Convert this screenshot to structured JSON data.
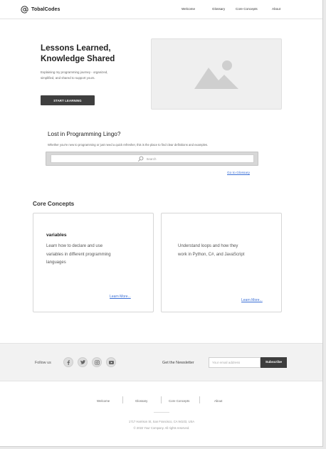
{
  "header": {
    "brand": "TobalCodes",
    "logo_icon": "at-sign-icon",
    "nav": [
      "Welcome",
      "Glossary",
      "Core Concepts",
      "About"
    ]
  },
  "hero": {
    "title_line1": "Lessons Learned,",
    "title_line2": "Knowledge Shared",
    "subtitle": "Explaining my programming journey - organized, simplified, and shared to support yours.",
    "button_label": "START LEARNING",
    "image_icon": "image-placeholder-icon"
  },
  "lingo": {
    "title": "Lost in Programming Lingo?",
    "subtitle": "Whether you're new to programming or just need a quick refresher, this is the place to find clear definitions and examples.",
    "search_placeholder": "Search",
    "glossary_link": "Go to Glossary"
  },
  "core_concepts": {
    "title": "Core Concepts",
    "cards": [
      {
        "title": "variables",
        "description": "Learn how to declare and use variables in different programming languages",
        "link": "Learn More..."
      },
      {
        "title": "",
        "description": "Understand loops and how they work in Python, C#, and JavaScript",
        "link": "Learn More..."
      }
    ]
  },
  "footer": {
    "follow_label": "Follow us",
    "social_icons": [
      "facebook-icon",
      "twitter-icon",
      "instagram-icon",
      "youtube-icon"
    ],
    "newsletter_label": "Get the Newsletter",
    "email_placeholder": "Your email address",
    "subscribe_label": "Subscribe",
    "nav": [
      "Welcome",
      "Glossary",
      "Core Concepts",
      "About"
    ],
    "address": "1717 Harrison St, San Francisco, CA 94103, USA",
    "copyright": "© 2022 Your Company.  All rights reserved."
  },
  "colors": {
    "link": "#3a6fd6",
    "button": "#3f3f3f",
    "footer_band": "#f2f2f2"
  }
}
